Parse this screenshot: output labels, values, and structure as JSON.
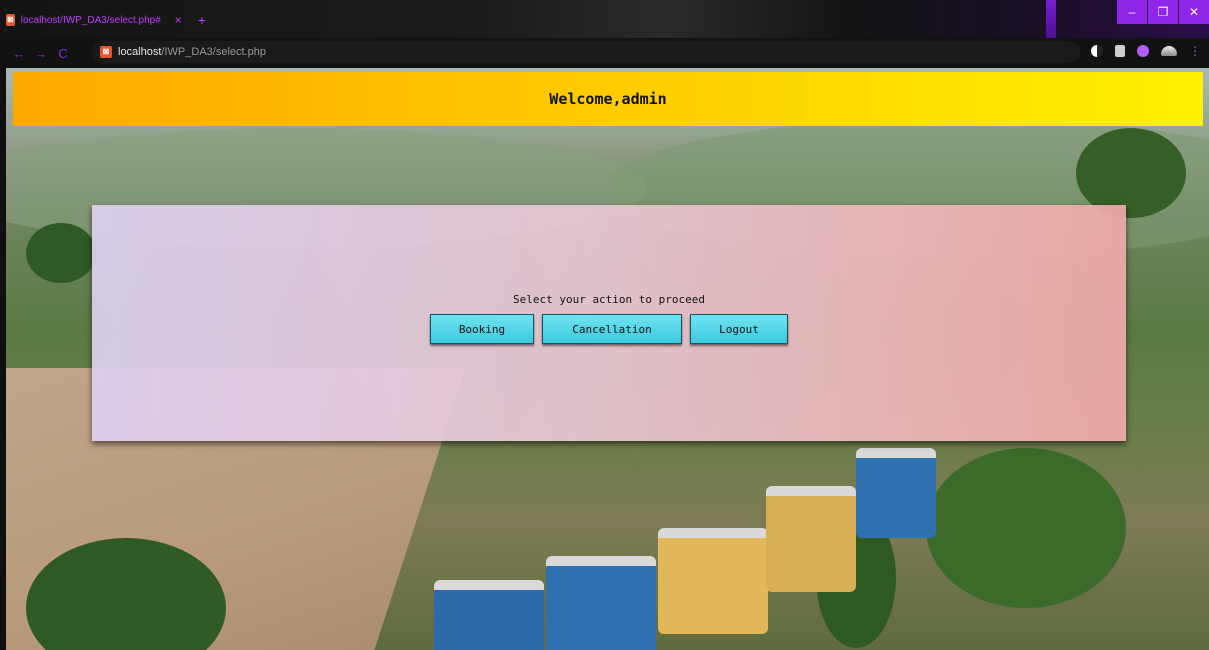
{
  "browser": {
    "tab_title": "localhost/IWP_DA3/select.php#",
    "tab_close": "×",
    "new_tab": "+",
    "url_host": "localhost",
    "url_path": "/IWP_DA3/select.php",
    "nav": {
      "back": "←",
      "forward": "→",
      "reload": "C"
    },
    "window": {
      "minimize": "–",
      "maximize": "❐",
      "close": "✕"
    },
    "accent_color": "#8f25e6"
  },
  "page": {
    "welcome": "Welcome,admin",
    "prompt": "Select your action to proceed",
    "buttons": {
      "booking": "Booking",
      "cancellation": "Cancellation",
      "logout": "Logout"
    },
    "colors": {
      "header_gradient": [
        "#ffa800",
        "#fff200"
      ],
      "button": "#3cc9e0"
    }
  }
}
